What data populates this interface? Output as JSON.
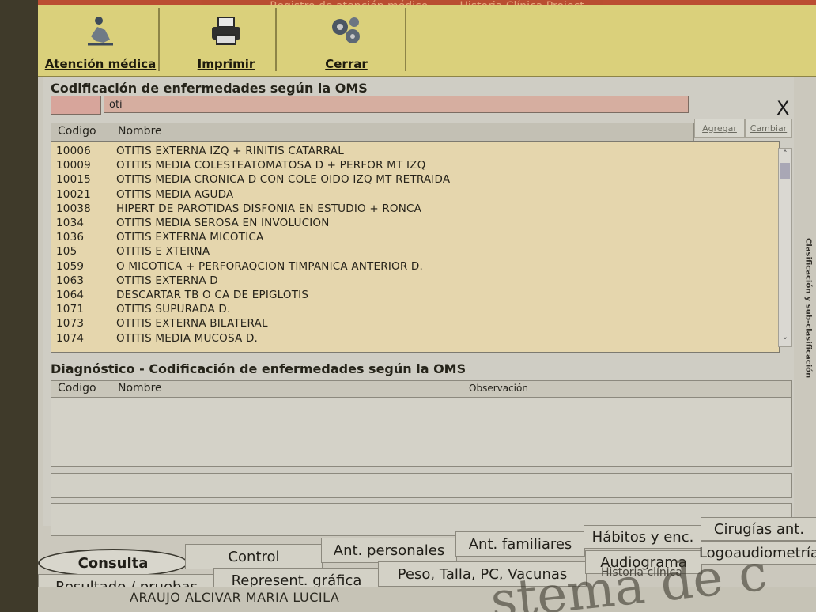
{
  "window": {
    "title": "Registro de atención médico",
    "title_extra": "Historia Clínica Project"
  },
  "toolbar": {
    "atencion_label": "Atención médica",
    "imprimir_label": "Imprimir",
    "cerrar_label": "Cerrar"
  },
  "search": {
    "section_title": "Codificación de enfermedades según la OMS",
    "query": "oti",
    "close_symbol": "X",
    "add_label": "Agregar",
    "change_label": "Cambiar"
  },
  "grid": {
    "columns": [
      "Codigo",
      "Nombre"
    ],
    "rows": [
      {
        "code": "10006",
        "name": "OTITIS EXTERNA IZQ + RINITIS CATARRAL"
      },
      {
        "code": "10009",
        "name": "OTITIS MEDIA COLESTEATOMATOSA D + PERFOR MT IZQ"
      },
      {
        "code": "10015",
        "name": "OTITIS MEDIA CRONICA D CON COLE OIDO IZQ MT RETRAIDA"
      },
      {
        "code": "10021",
        "name": "OTITIS MEDIA  AGUDA"
      },
      {
        "code": "10038",
        "name": "HIPERT DE PAROTIDAS DISFONIA EN ESTUDIO + RONCA"
      },
      {
        "code": "1034",
        "name": "OTITIS MEDIA SEROSA EN INVOLUCION"
      },
      {
        "code": "1036",
        "name": "OTITIS  EXTERNA MICOTICA"
      },
      {
        "code": "105",
        "name": "OTITIS E XTERNA"
      },
      {
        "code": "1059",
        "name": "O MICOTICA + PERFORAQCION TIMPANICA  ANTERIOR D."
      },
      {
        "code": "1063",
        "name": "OTITIS EXTERNA  D"
      },
      {
        "code": "1064",
        "name": "DESCARTAR TB O CA DE EPIGLOTIS"
      },
      {
        "code": "1071",
        "name": "OTITIS SUPURADA D."
      },
      {
        "code": "1073",
        "name": "OTITIS EXTERNA BILATERAL"
      },
      {
        "code": "1074",
        "name": "OTITIS MEDIA MUCOSA D."
      }
    ]
  },
  "side_tab": {
    "label": "Clasificación y sub-clasificación"
  },
  "diagnostico": {
    "section_title": "Diagnóstico - Codificación de enfermedades según la OMS",
    "col_codigo": "Codigo",
    "col_nombre": "Nombre",
    "col_observacion": "Observación"
  },
  "tabs": {
    "consulta": "Consulta",
    "control": "Control",
    "ant_personales": "Ant. personales",
    "ant_familiares": "Ant. familiares",
    "habitos": "Hábitos y enc.",
    "cirugias": "Cirugías ant.",
    "resultado": "Resultado / pruebas",
    "represent": "Represent. gráfica",
    "peso": "Peso, Talla, PC, Vacunas",
    "audiograma": "Audiograma",
    "logoaudiometria": "Logoaudiometría",
    "historia": "Historia clínica"
  },
  "patient": {
    "name": "ARAUJO ALCIVAR MARIA LUCILA"
  },
  "watermark": {
    "text": "stema de c"
  }
}
